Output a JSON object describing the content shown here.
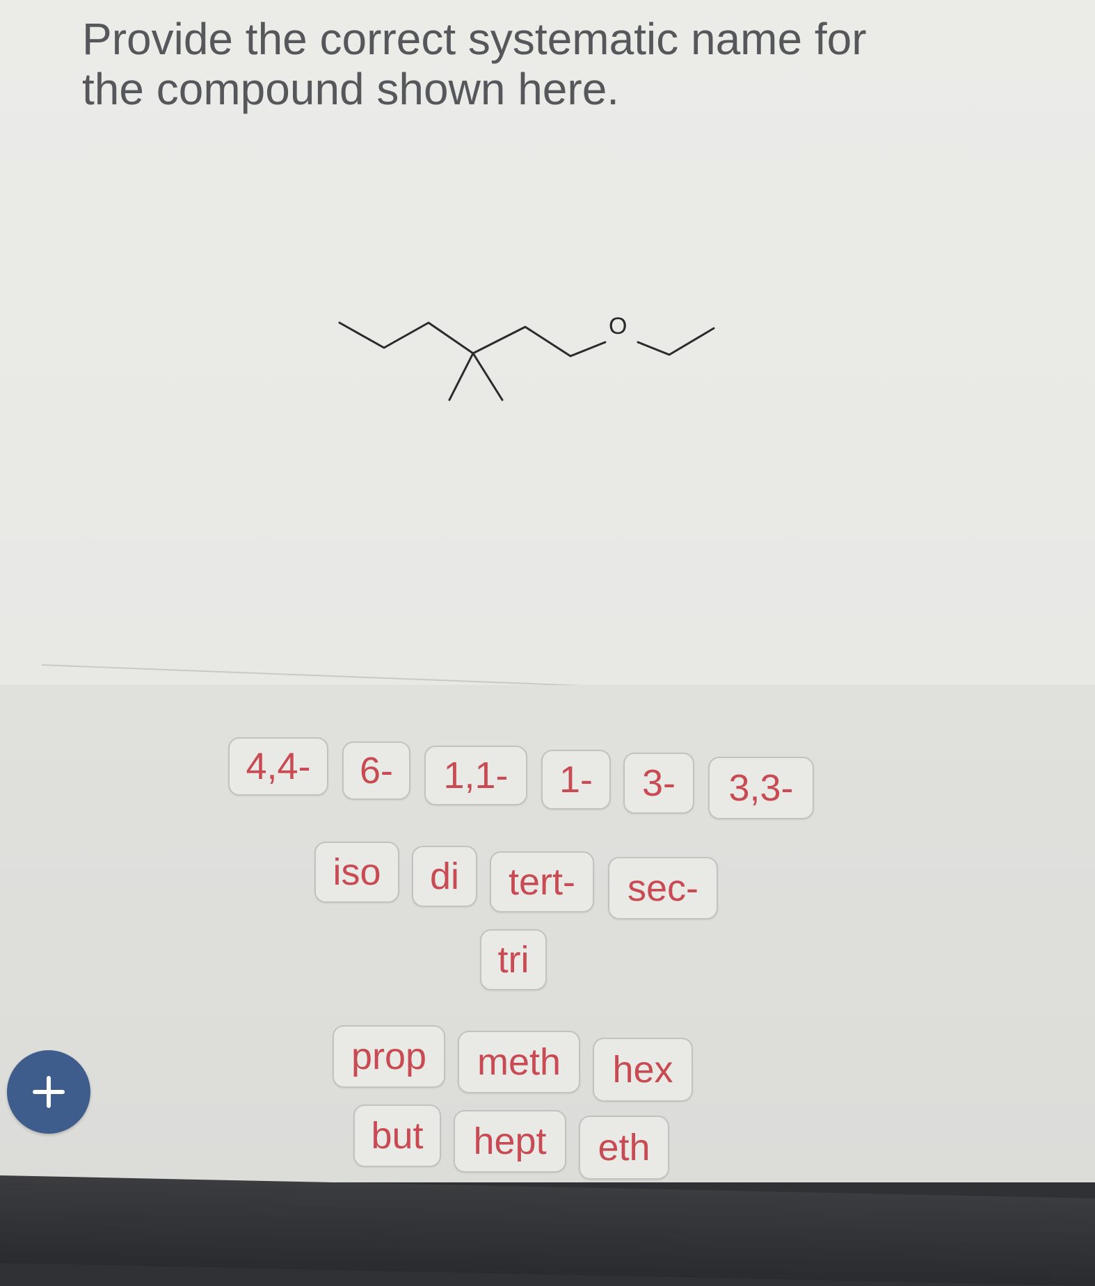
{
  "question": {
    "prompt": "Provide the correct systematic name for the compound shown here."
  },
  "molecule": {
    "oxygen_label": "O"
  },
  "tiles": {
    "locants": [
      "4,4-",
      "6-",
      "1,1-",
      "1-",
      "3-",
      "3,3-"
    ],
    "prefixes": [
      "iso",
      "di",
      "tert-",
      "sec-"
    ],
    "prefixes_row2": [
      "tri"
    ],
    "roots_row1": [
      "prop",
      "meth",
      "hex"
    ],
    "roots_row2": [
      "but",
      "hept",
      "eth"
    ]
  },
  "controls": {
    "add_symbol": "+"
  }
}
